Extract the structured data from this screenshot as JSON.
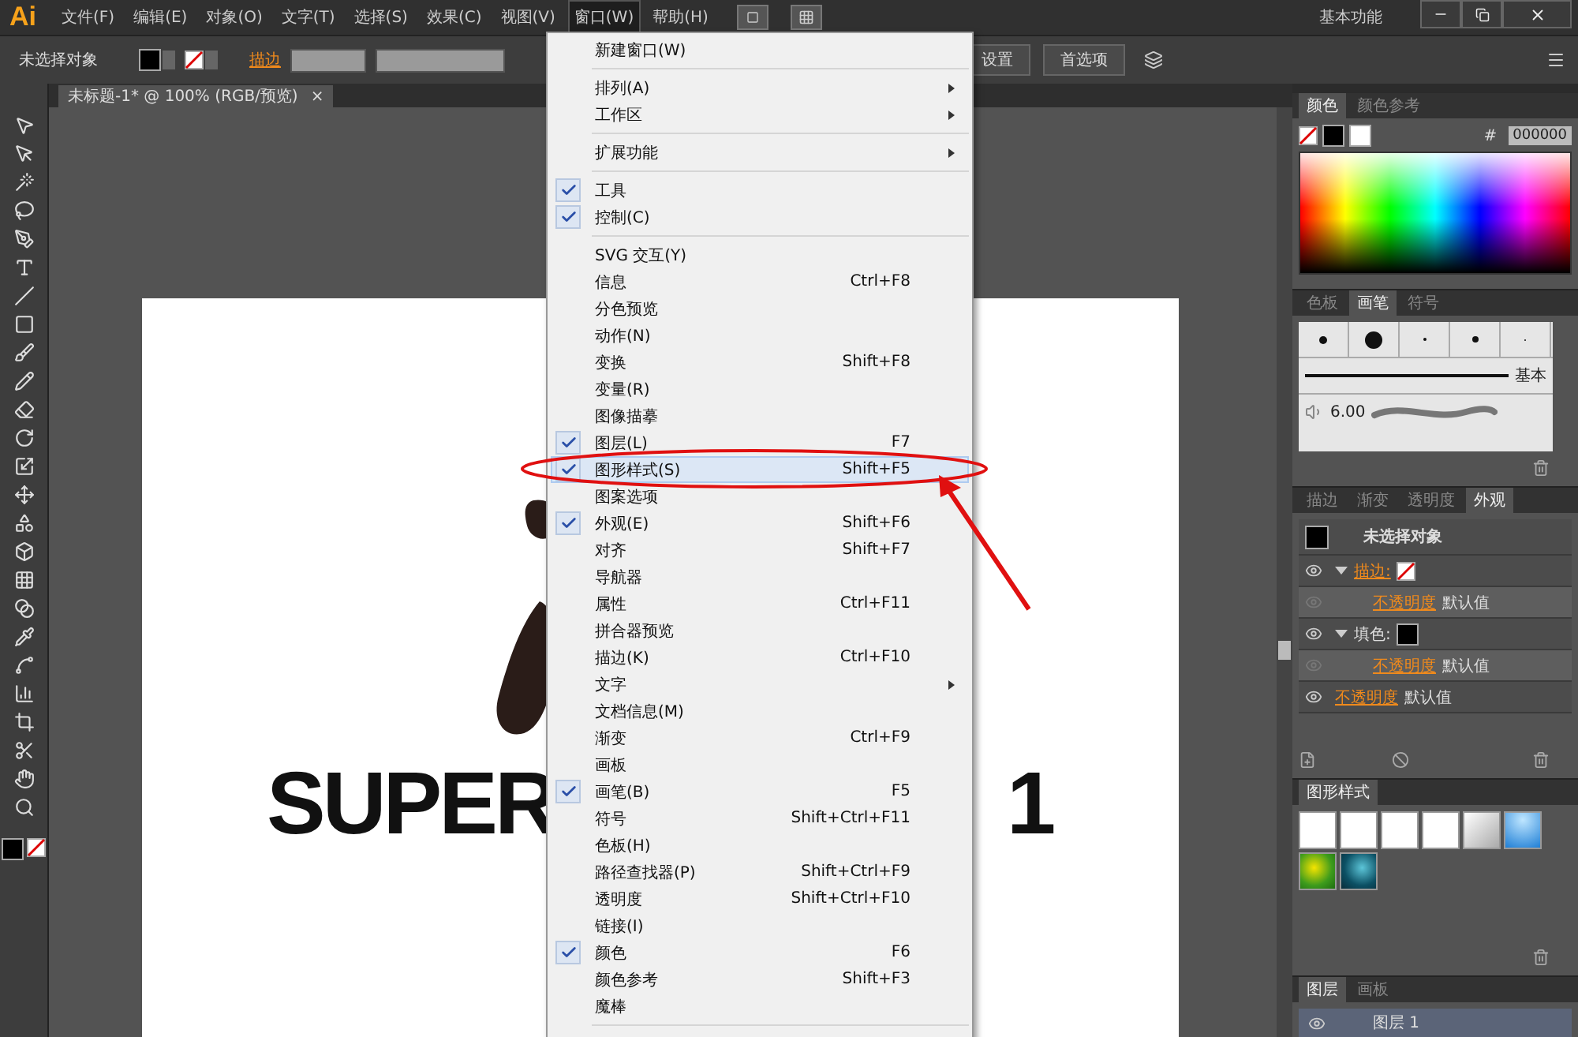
{
  "app_logo": "Ai",
  "menu_bar": [
    {
      "label": "文件(F)",
      "selected": false
    },
    {
      "label": "编辑(E)",
      "selected": false
    },
    {
      "label": "对象(O)",
      "selected": false
    },
    {
      "label": "文字(T)",
      "selected": false
    },
    {
      "label": "选择(S)",
      "selected": false
    },
    {
      "label": "效果(C)",
      "selected": false
    },
    {
      "label": "视图(V)",
      "selected": false
    },
    {
      "label": "窗口(W)",
      "selected": true
    },
    {
      "label": "帮助(H)",
      "selected": false
    }
  ],
  "workspace": "基本功能",
  "control_bar": {
    "selection": "未选择对象",
    "stroke_label": "描边",
    "document_settings": "设置",
    "preferences": "首选项"
  },
  "document_tab": {
    "title": "未标题-1* @ 100% (RGB/预览)",
    "close": "×"
  },
  "artboard": {
    "texts": [
      "SUPER",
      "1"
    ]
  },
  "window_menu": [
    {
      "kind": "item",
      "label": "新建窗口(W)",
      "checked": false,
      "submenu": false,
      "selected": false
    },
    {
      "kind": "separator"
    },
    {
      "kind": "item",
      "label": "排列(A)",
      "checked": false,
      "submenu": true,
      "selected": false
    },
    {
      "kind": "item",
      "label": "工作区",
      "checked": false,
      "submenu": true,
      "selected": false
    },
    {
      "kind": "separator"
    },
    {
      "kind": "item",
      "label": "扩展功能",
      "checked": false,
      "submenu": true,
      "selected": false
    },
    {
      "kind": "separator"
    },
    {
      "kind": "item",
      "label": "工具",
      "checked": true,
      "submenu": false,
      "selected": false
    },
    {
      "kind": "item",
      "label": "控制(C)",
      "checked": true,
      "submenu": false,
      "selected": false
    },
    {
      "kind": "separator"
    },
    {
      "kind": "item",
      "label": "SVG 交互(Y)",
      "checked": false,
      "submenu": false,
      "selected": false
    },
    {
      "kind": "item",
      "label": "信息",
      "shortcut": "Ctrl+F8",
      "checked": false,
      "submenu": false,
      "selected": false
    },
    {
      "kind": "item",
      "label": "分色预览",
      "checked": false,
      "submenu": false,
      "selected": false
    },
    {
      "kind": "item",
      "label": "动作(N)",
      "checked": false,
      "submenu": false,
      "selected": false
    },
    {
      "kind": "item",
      "label": "变换",
      "shortcut": "Shift+F8",
      "checked": false,
      "submenu": false,
      "selected": false
    },
    {
      "kind": "item",
      "label": "变量(R)",
      "checked": false,
      "submenu": false,
      "selected": false
    },
    {
      "kind": "item",
      "label": "图像描摹",
      "checked": false,
      "submenu": false,
      "selected": false
    },
    {
      "kind": "item",
      "label": "图层(L)",
      "shortcut": "F7",
      "checked": true,
      "submenu": false,
      "selected": false
    },
    {
      "kind": "item",
      "label": "图形样式(S)",
      "shortcut": "Shift+F5",
      "checked": true,
      "submenu": false,
      "selected": true
    },
    {
      "kind": "item",
      "label": "图案选项",
      "checked": false,
      "submenu": false,
      "selected": false
    },
    {
      "kind": "item",
      "label": "外观(E)",
      "shortcut": "Shift+F6",
      "checked": true,
      "submenu": false,
      "selected": false
    },
    {
      "kind": "item",
      "label": "对齐",
      "shortcut": "Shift+F7",
      "checked": false,
      "submenu": false,
      "selected": false
    },
    {
      "kind": "item",
      "label": "导航器",
      "checked": false,
      "submenu": false,
      "selected": false
    },
    {
      "kind": "item",
      "label": "属性",
      "shortcut": "Ctrl+F11",
      "checked": false,
      "submenu": false,
      "selected": false
    },
    {
      "kind": "item",
      "label": "拼合器预览",
      "checked": false,
      "submenu": false,
      "selected": false
    },
    {
      "kind": "item",
      "label": "描边(K)",
      "shortcut": "Ctrl+F10",
      "checked": false,
      "submenu": false,
      "selected": false
    },
    {
      "kind": "item",
      "label": "文字",
      "checked": false,
      "submenu": true,
      "selected": false
    },
    {
      "kind": "item",
      "label": "文档信息(M)",
      "checked": false,
      "submenu": false,
      "selected": false
    },
    {
      "kind": "item",
      "label": "渐变",
      "shortcut": "Ctrl+F9",
      "checked": false,
      "submenu": false,
      "selected": false
    },
    {
      "kind": "item",
      "label": "画板",
      "checked": false,
      "submenu": false,
      "selected": false
    },
    {
      "kind": "item",
      "label": "画笔(B)",
      "shortcut": "F5",
      "checked": true,
      "submenu": false,
      "selected": false
    },
    {
      "kind": "item",
      "label": "符号",
      "shortcut": "Shift+Ctrl+F11",
      "checked": false,
      "submenu": false,
      "selected": false
    },
    {
      "kind": "item",
      "label": "色板(H)",
      "checked": false,
      "submenu": false,
      "selected": false
    },
    {
      "kind": "item",
      "label": "路径查找器(P)",
      "shortcut": "Shift+Ctrl+F9",
      "checked": false,
      "submenu": false,
      "selected": false
    },
    {
      "kind": "item",
      "label": "透明度",
      "shortcut": "Shift+Ctrl+F10",
      "checked": false,
      "submenu": false,
      "selected": false
    },
    {
      "kind": "item",
      "label": "链接(I)",
      "checked": false,
      "submenu": false,
      "selected": false
    },
    {
      "kind": "item",
      "label": "颜色",
      "shortcut": "F6",
      "checked": true,
      "submenu": false,
      "selected": false
    },
    {
      "kind": "item",
      "label": "颜色参考",
      "shortcut": "Shift+F3",
      "checked": false,
      "submenu": false,
      "selected": false
    },
    {
      "kind": "item",
      "label": "魔棒",
      "checked": false,
      "submenu": false,
      "selected": false
    },
    {
      "kind": "separator"
    }
  ],
  "color_panel": {
    "tabs": [
      {
        "label": "颜色",
        "selected": true
      },
      {
        "label": "颜色参考",
        "selected": false
      }
    ],
    "hash": "#",
    "hex": "000000"
  },
  "brushes_panel": {
    "tabs": [
      {
        "label": "色板",
        "selected": false
      },
      {
        "label": "画笔",
        "selected": true
      },
      {
        "label": "符号",
        "selected": false
      }
    ],
    "basic_label": "基本",
    "size": "6.00"
  },
  "appearance_panel": {
    "tabs": [
      {
        "label": "描边",
        "selected": false
      },
      {
        "label": "渐变",
        "selected": false
      },
      {
        "label": "透明度",
        "selected": false
      },
      {
        "label": "外观",
        "selected": true
      }
    ],
    "title": "未选择对象",
    "rows": [
      {
        "kind": "stroke",
        "label": "描边:",
        "expanded": true,
        "children": [
          {
            "kind": "opacity",
            "label": "不透明度",
            "value": "默认值"
          }
        ]
      },
      {
        "kind": "fill",
        "label": "填色:",
        "expanded": true,
        "children": [
          {
            "kind": "opacity",
            "label": "不透明度",
            "value": "默认值"
          }
        ]
      },
      {
        "kind": "opacity",
        "label": "不透明度",
        "value": "默认值"
      }
    ]
  },
  "graphic_styles_panel": {
    "title": "图形样式"
  },
  "layers_panel": {
    "tabs": [
      {
        "label": "图层",
        "selected": true
      },
      {
        "label": "画板",
        "selected": false
      }
    ],
    "layer": "图层 1"
  }
}
